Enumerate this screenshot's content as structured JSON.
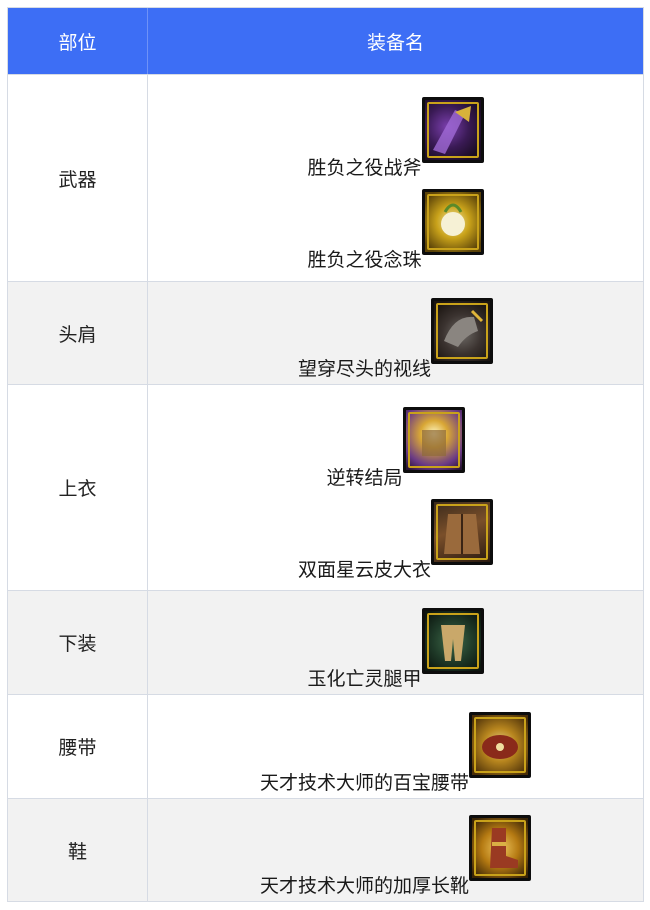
{
  "header": {
    "part_label": "部位",
    "name_label": "装备名"
  },
  "rows": [
    {
      "part": "武器",
      "items": [
        {
          "name": "胜负之役战斧",
          "icon": "axe-icon"
        },
        {
          "name": "胜负之役念珠",
          "icon": "rosary-icon"
        }
      ]
    },
    {
      "part": "头肩",
      "items": [
        {
          "name": "望穿尽头的视线",
          "icon": "shoulder-icon"
        }
      ]
    },
    {
      "part": "上衣",
      "items": [
        {
          "name": "逆转结局",
          "icon": "top-armor-icon"
        },
        {
          "name": "双面星云皮大衣",
          "icon": "coat-icon"
        }
      ]
    },
    {
      "part": "下装",
      "items": [
        {
          "name": "玉化亡灵腿甲",
          "icon": "leg-armor-icon"
        }
      ]
    },
    {
      "part": "腰带",
      "items": [
        {
          "name": "天才技术大师的百宝腰带",
          "icon": "belt-icon"
        }
      ]
    },
    {
      "part": "鞋",
      "items": [
        {
          "name": "天才技术大师的加厚长靴",
          "icon": "boots-icon"
        }
      ]
    }
  ],
  "colors": {
    "header_bg": "#3d6ef5",
    "row_gray": "#f2f2f2",
    "border": "#d6dbe4"
  }
}
